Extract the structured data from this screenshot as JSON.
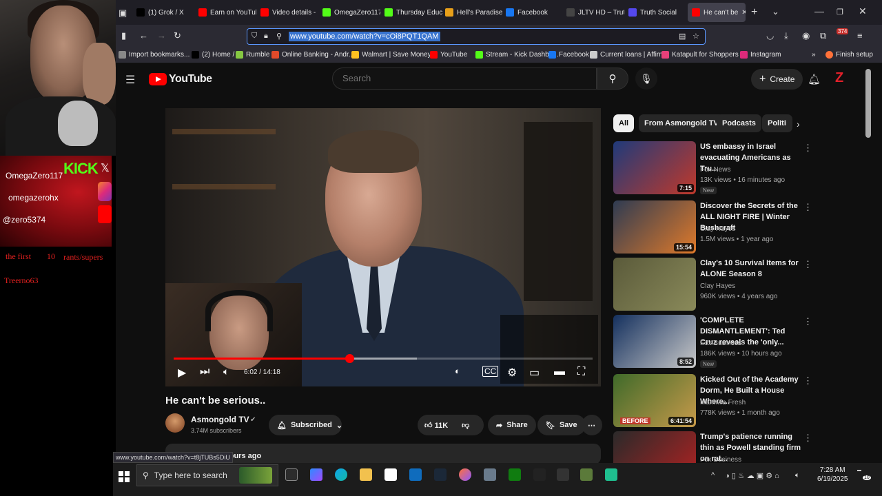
{
  "overlay": {
    "social_handles": [
      "OmegaZero117",
      "omegazerohx",
      "@zero5374"
    ],
    "kick_label": "KICK",
    "rants_prefix": "the first",
    "rants_count": "10",
    "rants_suffix": "rants/supers",
    "rant_name": "Treerno63"
  },
  "browser": {
    "tabs": [
      {
        "label": "(1) Grok / X",
        "color": "#000000",
        "icon": "x-icon"
      },
      {
        "label": "Earn on YouTub",
        "color": "#ff0000",
        "icon": "youtube-icon"
      },
      {
        "label": "Video details -",
        "color": "#ff0000",
        "icon": "youtube-icon"
      },
      {
        "label": "OmegaZero117",
        "color": "#53fc18",
        "icon": "kick-icon"
      },
      {
        "label": "Thursday Educ",
        "color": "#53fc18",
        "icon": "rumble-icon"
      },
      {
        "label": "Hell's Paradise",
        "color": "#e8a01a",
        "icon": "bookmark-icon"
      },
      {
        "label": "Facebook",
        "color": "#1877f2",
        "icon": "facebook-icon"
      },
      {
        "label": "JLTV HD – Trut",
        "color": "#444444",
        "icon": "star-icon"
      },
      {
        "label": "Truth Social",
        "color": "#5448ee",
        "icon": "truth-social-icon"
      },
      {
        "label": "He can't be",
        "color": "#ff0000",
        "icon": "youtube-icon"
      }
    ],
    "url": "www.youtube.com/watch?v=cOi8PQT1QAM",
    "ext_badge": "374",
    "bookmarks": [
      {
        "label": "Import bookmarks...",
        "color": "#888888"
      },
      {
        "label": "(2) Home / X",
        "color": "#000000"
      },
      {
        "label": "Rumble",
        "color": "#85c742"
      },
      {
        "label": "Online Banking - Andr...",
        "color": "#e24a2a"
      },
      {
        "label": "Walmart | Save Money...",
        "color": "#ffc220"
      },
      {
        "label": "YouTube",
        "color": "#ff0000"
      },
      {
        "label": "Stream - Kick Dashbo...",
        "color": "#53fc18"
      },
      {
        "label": "Facebook",
        "color": "#1877f2"
      },
      {
        "label": "Current loans | Affirm",
        "color": "#cccccc"
      },
      {
        "label": "Katapult for Shoppers ...",
        "color": "#e8407a"
      },
      {
        "label": "Instagram",
        "color": "#dd2a7b"
      }
    ],
    "finish_setup": "Finish setup"
  },
  "youtube": {
    "logo_text": "YouTube",
    "search_placeholder": "Search",
    "create_label": "Create",
    "video": {
      "time": "6:02 / 14:18",
      "progress": 0.42,
      "buffered": 0.58,
      "title": "He can't be serious..",
      "channel": "Asmongold TV",
      "subscribers": "3.74M subscribers",
      "subscribe_label": "Subscribed",
      "likes": "11K",
      "share_label": "Share",
      "save_label": "Save",
      "desc_fragment": "hours ago"
    },
    "chips": [
      "All",
      "From Asmongold TV",
      "Podcasts",
      "Politi"
    ],
    "related": [
      {
        "title": "US embassy in Israel evacuating Americans as Tru...",
        "channel": "Fox News",
        "meta": "13K views • 16 minutes ago",
        "duration": "7:15",
        "new": "New",
        "thumb": [
          "#1f3a7a",
          "#c0392b"
        ]
      },
      {
        "title": "Discover the Secrets of the ALL NIGHT FIRE | Winter Bushcraft",
        "channel": "Clay Hayes",
        "meta": "1.5M views • 1 year ago",
        "duration": "15:54",
        "new": "",
        "thumb": [
          "#2e3b52",
          "#e07a2a"
        ]
      },
      {
        "title": "Clay's 10 Survival Items for ALONE Season 8",
        "channel": "Clay Hayes",
        "meta": "960K views • 4 years ago",
        "duration": "",
        "new": "",
        "thumb": [
          "#5a5a3a",
          "#8a8a5a"
        ]
      },
      {
        "title": "'COMPLETE DISMANTLEMENT': Ted Cruz reveals the 'only...",
        "channel": "Fox Business",
        "meta": "186K views • 10 hours ago",
        "duration": "8:52",
        "new": "New",
        "thumb": [
          "#14305e",
          "#c8c8c8"
        ]
      },
      {
        "title": "Kicked Out of the Academy Dorm, He Built a House Where...",
        "channel": "Manhwa Fresh",
        "meta": "778K views • 1 month ago",
        "duration": "6:41:54",
        "new": "",
        "thumb": [
          "#3f6a2a",
          "#c79a4a"
        ],
        "badge": "BEFORE"
      },
      {
        "title": "Trump's patience running thin as Powell standing firm on rat...",
        "channel": "Fox Business",
        "meta": "",
        "duration": "",
        "new": "",
        "thumb": [
          "#2a2a2a",
          "#b22222"
        ]
      }
    ]
  },
  "status_url": "www.youtube.com/watch?v=t8jTUBs5DiU",
  "taskbar": {
    "search_placeholder": "Type here to search",
    "time": "7:28 AM",
    "date": "6/19/2025",
    "notif_count": "10"
  }
}
